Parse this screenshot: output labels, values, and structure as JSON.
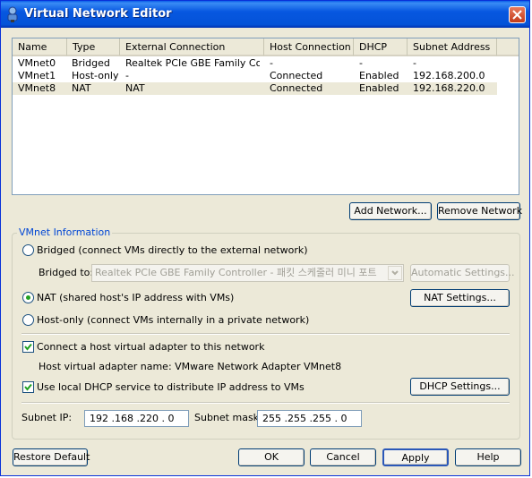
{
  "window": {
    "title": "Virtual Network Editor"
  },
  "network_list": {
    "columns": [
      "Name",
      "Type",
      "External Connection",
      "Host Connection",
      "DHCP",
      "Subnet Address"
    ],
    "rows": [
      {
        "name": "VMnet0",
        "type": "Bridged",
        "external": "Realtek PCIe GBE Family Co...",
        "host": "-",
        "dhcp": "-",
        "subnet": "-"
      },
      {
        "name": "VMnet1",
        "type": "Host-only",
        "external": "-",
        "host": "Connected",
        "dhcp": "Enabled",
        "subnet": "192.168.200.0"
      },
      {
        "name": "VMnet8",
        "type": "NAT",
        "external": "NAT",
        "host": "Connected",
        "dhcp": "Enabled",
        "subnet": "192.168.220.0"
      }
    ],
    "selected_row": "VMnet8"
  },
  "list_buttons": {
    "add_network": "Add Network...",
    "remove_network": "Remove Network"
  },
  "vmnet_info": {
    "group_title": "VMnet Information",
    "bridged_label": "Bridged (connect VMs directly to the external network)",
    "bridged_to_label": "Bridged to:",
    "bridged_to_value": "Realtek PCIe GBE Family Controller - 패킷 스케줄러 미니 포트",
    "automatic_settings": "Automatic Settings...",
    "nat_label": "NAT (shared host's IP address with VMs)",
    "nat_settings": "NAT Settings...",
    "hostonly_label": "Host-only (connect VMs internally in a private network)",
    "selected_mode": "NAT",
    "connect_adapter_label": "Connect a host virtual adapter to this network",
    "connect_adapter_checked": true,
    "adapter_name_text": "Host virtual adapter name: VMware Network Adapter VMnet8",
    "dhcp_label": "Use local DHCP service to distribute IP address to VMs",
    "dhcp_checked": true,
    "dhcp_settings": "DHCP Settings...",
    "subnet_ip_label": "Subnet IP:",
    "subnet_ip_value": "192 .168 .220 . 0",
    "subnet_mask_label": "Subnet mask:",
    "subnet_mask_value": "255 .255 .255 . 0"
  },
  "footer_buttons": {
    "restore_default": "Restore Default",
    "ok": "OK",
    "cancel": "Cancel",
    "apply": "Apply",
    "help": "Help"
  },
  "colors": {
    "titlebar": "#0453d8",
    "dialog_bg": "#ece9d8",
    "group_title": "#0046d5",
    "selected_row": "#ece9d8"
  }
}
